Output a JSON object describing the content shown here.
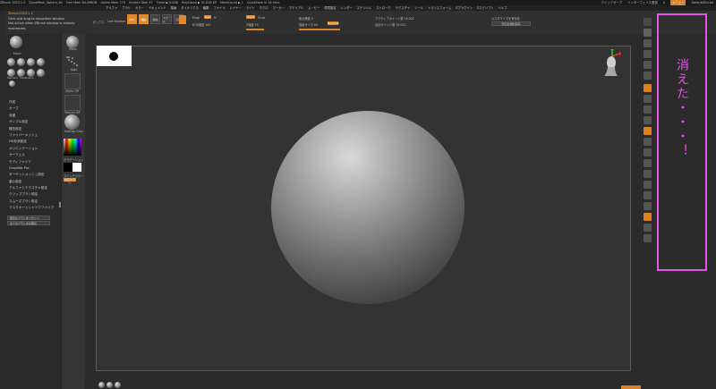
{
  "titlebar": {
    "app": "ZBrush 2023.1.2",
    "file": "DynaMesh_Sphere_64",
    "segments": [
      "Free Mem 84.496GB",
      "Active Mem 779",
      "Scratch Disk 47",
      "Timer ▶ 0.008",
      "PolyCount ▶ 31.816 KP",
      "MeshCount ▶ 1",
      "QuickSave In 16 Secs"
    ],
    "right": [
      "クイックセーブ",
      "インターフェイス透過",
      "0",
      "メニュー",
      "DefaultZScript"
    ]
  },
  "menubar": {
    "items": [
      "アルファ",
      "ブラシ",
      "カラー",
      "ドキュメント",
      "描画",
      "ダイナミクス",
      "編集",
      "ファイル",
      "レイヤー",
      "ライト",
      "マクロ",
      "マーカー",
      "マテリアル",
      "ムービー",
      "環境設定",
      "レンダー",
      "ステンシル",
      "ストローク",
      "テクスチャ",
      "ツール",
      "トランスフォーム",
      "Zプラグイン",
      "Zスクリプト",
      "ヘルプ"
    ]
  },
  "tooltip": {
    "title": "Zbrush2023.1.2",
    "line1": "Click and drag to reposition window.",
    "line2": "Not active when ZBrush window is already",
    "line3": "maximized."
  },
  "shelf": {
    "lightbox": "ライトボックス",
    "liveboolean": "Live Boolean",
    "edit": "Edit",
    "draw": "描画",
    "move": "移動",
    "scale": "スケール",
    "rotate": "回転",
    "mrgb": "Mrgb",
    "rgb": "Rgb",
    "m": "M",
    "zadd": "Zadd",
    "zsub": "Zsub",
    "zcut": "Zcut",
    "rgb_intensity": "RGB強度 100",
    "z_intensity": "Z強度 25",
    "focal_shift": "焦点移動 0",
    "draw_size": "描画サイズ 64",
    "dynamic": "Dynamic",
    "active_points": "アクティブポイント数 16.002",
    "total_points": "合計ポイント数 16.002",
    "customize": "カスタマイズを有効化",
    "default_dir": "既定名規則保存"
  },
  "leftpanel": {
    "brush_label": "Move",
    "brush_names": [
      "Standard",
      "ClayBuildup",
      "DamStandard",
      "Move",
      "TrimDynamic",
      "hPolish",
      "Inflate",
      "Pinch"
    ],
    "dots_label": "Dots",
    "alpha_label": "Alpha Off",
    "texture_label": "Texture Off",
    "material_label": "MatCap Gray",
    "gradient_label": "グラデーション",
    "switch_label": "スイッチカラー",
    "alternate_label": "交互カラー",
    "menu": [
      "作成",
      "カーブ",
      "深度",
      "サンプル設定",
      "雛形設定",
      "ファイバーメッシュ",
      "HD形状設定",
      "オリエンテーション",
      "サーフェス",
      "モディファイア",
      "Graphite Pro",
      "ターゲットメッシュ設定",
      "重心設定",
      "アルファとテクスチャ設定",
      "クリップブラシ設定",
      "スムーズブラシ設定",
      "マスクオートシャドウファイア"
    ],
    "footer1": "既定のブラシをリセット",
    "footer2": "全てのブラシを初期化"
  },
  "annotation": {
    "text": "消えた・・・！",
    "color": "#e256e6"
  },
  "colors": {
    "accent": "#d98028",
    "background": "#2b2b2b",
    "canvas": "#333333"
  }
}
